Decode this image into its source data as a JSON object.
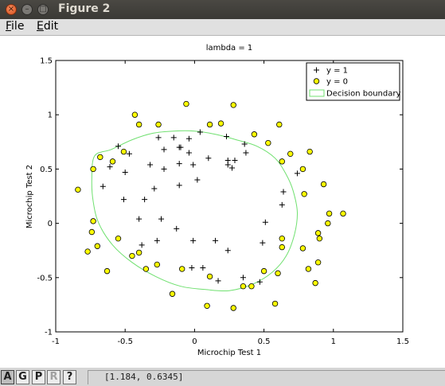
{
  "window": {
    "title": "Figure 2"
  },
  "menu": {
    "file": "File",
    "edit": "Edit",
    "file_key": "F",
    "file_rest": "ile",
    "edit_key": "E",
    "edit_rest": "dit"
  },
  "toolbar": {
    "buttons": [
      "A",
      "G",
      "P",
      "R",
      "?"
    ],
    "coords": "[1.184, 0.6345]"
  },
  "chart_data": {
    "type": "scatter",
    "title": "lambda = 1",
    "xlabel": "Microchip Test 1",
    "ylabel": "Microchip Test 2",
    "xlim": [
      -1,
      1.5
    ],
    "ylim": [
      -1,
      1.5
    ],
    "xticks": [
      "-1",
      "-0.5",
      "0",
      "0.5",
      "1",
      "1.5"
    ],
    "yticks": [
      "1.5",
      "1",
      "0.5",
      "0",
      "-0.5",
      "-1"
    ],
    "grid": false,
    "legend": {
      "position": "top-right",
      "entries": [
        "y = 1",
        "y = 0",
        "Decision boundary"
      ]
    },
    "colors": {
      "positive": "#000000",
      "negative_fill": "#ffff00",
      "boundary": "#70e070"
    },
    "series": [
      {
        "name": "y = 1",
        "marker": "+",
        "points": [
          [
            -0.1,
            0.7
          ],
          [
            -0.22,
            0.68
          ],
          [
            -0.26,
            0.79
          ],
          [
            -0.15,
            0.79
          ],
          [
            -0.11,
            0.7
          ],
          [
            -0.04,
            0.65
          ],
          [
            -0.04,
            0.78
          ],
          [
            0.04,
            0.84
          ],
          [
            0.1,
            0.6
          ],
          [
            0.23,
            0.8
          ],
          [
            0.24,
            0.58
          ],
          [
            0.29,
            0.58
          ],
          [
            0.27,
            0.51
          ],
          [
            0.24,
            0.54
          ],
          [
            0.36,
            0.73
          ],
          [
            0.37,
            0.65
          ],
          [
            -0.55,
            0.71
          ],
          [
            -0.61,
            0.52
          ],
          [
            -0.5,
            0.47
          ],
          [
            -0.47,
            0.64
          ],
          [
            -0.32,
            0.54
          ],
          [
            -0.22,
            0.5
          ],
          [
            -0.11,
            0.55
          ],
          [
            -0.01,
            0.54
          ],
          [
            0.02,
            0.4
          ],
          [
            -0.66,
            0.34
          ],
          [
            -0.51,
            0.22
          ],
          [
            -0.36,
            0.22
          ],
          [
            -0.29,
            0.32
          ],
          [
            -0.11,
            0.35
          ],
          [
            -0.4,
            0.04
          ],
          [
            -0.24,
            0.04
          ],
          [
            -0.13,
            -0.05
          ],
          [
            -0.27,
            -0.16
          ],
          [
            -0.38,
            -0.2
          ],
          [
            -0.01,
            -0.16
          ],
          [
            0.15,
            -0.16
          ],
          [
            0.24,
            -0.25
          ],
          [
            0.49,
            -0.18
          ],
          [
            0.51,
            0.01
          ],
          [
            0.64,
            0.29
          ],
          [
            0.74,
            0.46
          ],
          [
            0.63,
            0.17
          ],
          [
            -0.02,
            -0.41
          ],
          [
            0.06,
            -0.41
          ],
          [
            0.17,
            -0.53
          ],
          [
            0.35,
            -0.5
          ],
          [
            0.47,
            -0.54
          ]
        ]
      },
      {
        "name": "y = 0",
        "marker": "o",
        "points": [
          [
            -0.84,
            0.31
          ],
          [
            -0.73,
            0.5
          ],
          [
            -0.68,
            0.61
          ],
          [
            -0.59,
            0.57
          ],
          [
            -0.51,
            0.66
          ],
          [
            -0.4,
            0.91
          ],
          [
            -0.43,
            1.0
          ],
          [
            -0.26,
            0.91
          ],
          [
            -0.06,
            1.1
          ],
          [
            0.11,
            0.91
          ],
          [
            0.19,
            0.92
          ],
          [
            0.28,
            1.09
          ],
          [
            0.43,
            0.82
          ],
          [
            0.53,
            0.74
          ],
          [
            0.61,
            0.91
          ],
          [
            0.63,
            0.57
          ],
          [
            0.69,
            0.64
          ],
          [
            0.78,
            0.5
          ],
          [
            0.83,
            0.66
          ],
          [
            0.79,
            0.27
          ],
          [
            0.93,
            0.36
          ],
          [
            0.97,
            0.09
          ],
          [
            0.96,
            0.0
          ],
          [
            1.07,
            0.09
          ],
          [
            -0.73,
            0.02
          ],
          [
            -0.74,
            -0.08
          ],
          [
            -0.77,
            -0.26
          ],
          [
            -0.7,
            -0.21
          ],
          [
            -0.63,
            -0.44
          ],
          [
            -0.55,
            -0.14
          ],
          [
            -0.45,
            -0.3
          ],
          [
            -0.4,
            -0.27
          ],
          [
            -0.35,
            -0.42
          ],
          [
            -0.27,
            -0.38
          ],
          [
            -0.09,
            -0.42
          ],
          [
            -0.16,
            -0.65
          ],
          [
            0.11,
            -0.49
          ],
          [
            0.09,
            -0.76
          ],
          [
            0.28,
            -0.78
          ],
          [
            0.35,
            -0.58
          ],
          [
            0.41,
            -0.58
          ],
          [
            0.58,
            -0.74
          ],
          [
            0.5,
            -0.44
          ],
          [
            0.6,
            -0.46
          ],
          [
            0.63,
            -0.22
          ],
          [
            0.63,
            -0.14
          ],
          [
            0.78,
            -0.23
          ],
          [
            0.82,
            -0.42
          ],
          [
            0.87,
            -0.55
          ],
          [
            0.89,
            -0.36
          ],
          [
            0.89,
            -0.09
          ],
          [
            0.9,
            -0.14
          ]
        ]
      }
    ],
    "boundary": {
      "name": "Decision boundary",
      "shape": "closed-curve",
      "points": [
        [
          -0.72,
          0.62
        ],
        [
          -0.6,
          0.68
        ],
        [
          -0.45,
          0.77
        ],
        [
          -0.3,
          0.83
        ],
        [
          -0.15,
          0.85
        ],
        [
          0.0,
          0.85
        ],
        [
          0.15,
          0.82
        ],
        [
          0.3,
          0.77
        ],
        [
          0.45,
          0.71
        ],
        [
          0.58,
          0.6
        ],
        [
          0.66,
          0.45
        ],
        [
          0.71,
          0.3
        ],
        [
          0.74,
          0.1
        ],
        [
          0.72,
          -0.1
        ],
        [
          0.66,
          -0.3
        ],
        [
          0.56,
          -0.45
        ],
        [
          0.42,
          -0.56
        ],
        [
          0.25,
          -0.62
        ],
        [
          0.08,
          -0.61
        ],
        [
          -0.1,
          -0.58
        ],
        [
          -0.28,
          -0.49
        ],
        [
          -0.45,
          -0.36
        ],
        [
          -0.59,
          -0.2
        ],
        [
          -0.69,
          0.0
        ],
        [
          -0.73,
          0.2
        ],
        [
          -0.74,
          0.4
        ],
        [
          -0.72,
          0.62
        ]
      ]
    }
  }
}
